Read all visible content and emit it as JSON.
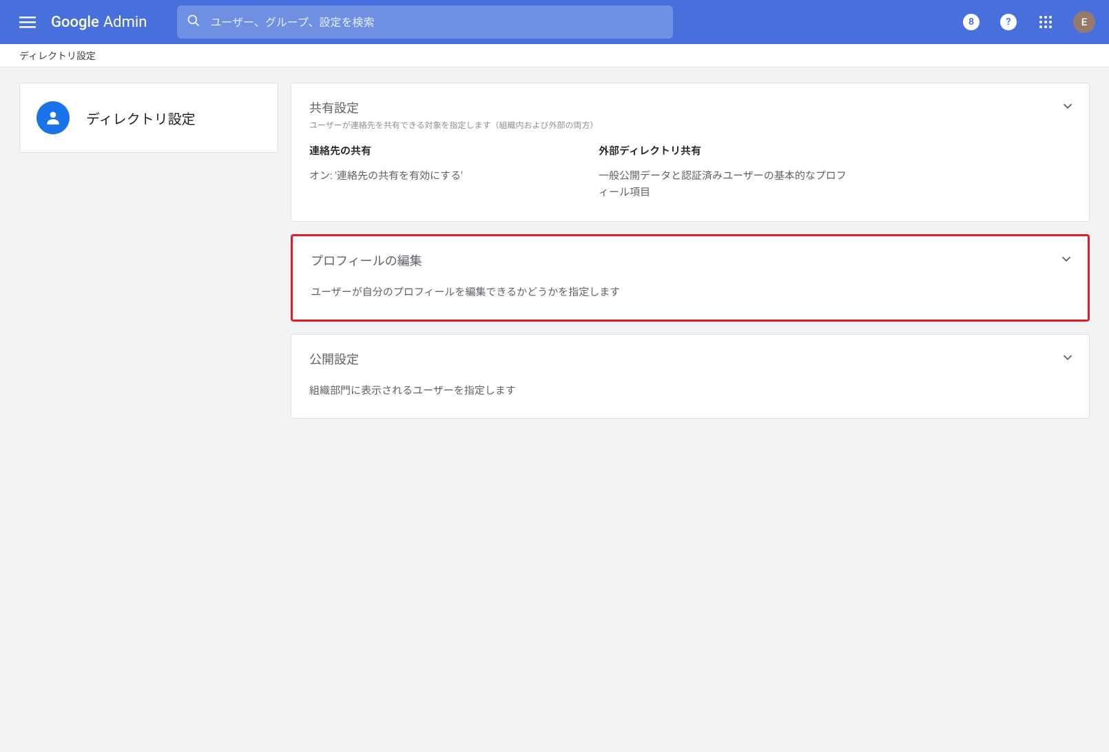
{
  "header": {
    "logo_primary": "Google",
    "logo_secondary": "Admin",
    "search_placeholder": "ユーザー、グループ、設定を検索",
    "notification_char": "8",
    "help_char": "?",
    "avatar_initial": "E"
  },
  "breadcrumb": "ディレクトリ設定",
  "left_card": {
    "title": "ディレクトリ設定"
  },
  "cards": {
    "share": {
      "title": "共有設定",
      "subtitle": "ユーザーが連絡先を共有できる対象を指定します（組織内および外部の両方）",
      "contact_sharing": {
        "title": "連絡先の共有",
        "status": "オン: '連絡先の共有を有効にする'"
      },
      "external_sharing": {
        "title": "外部ディレクトリ共有",
        "status": "一般公開データと認証済みユーザーの基本的なプロフィール項目"
      }
    },
    "profile_edit": {
      "title": "プロフィールの編集",
      "desc": "ユーザーが自分のプロフィールを編集できるかどうかを指定します"
    },
    "visibility": {
      "title": "公開設定",
      "desc": "組織部門に表示されるユーザーを指定します"
    }
  }
}
